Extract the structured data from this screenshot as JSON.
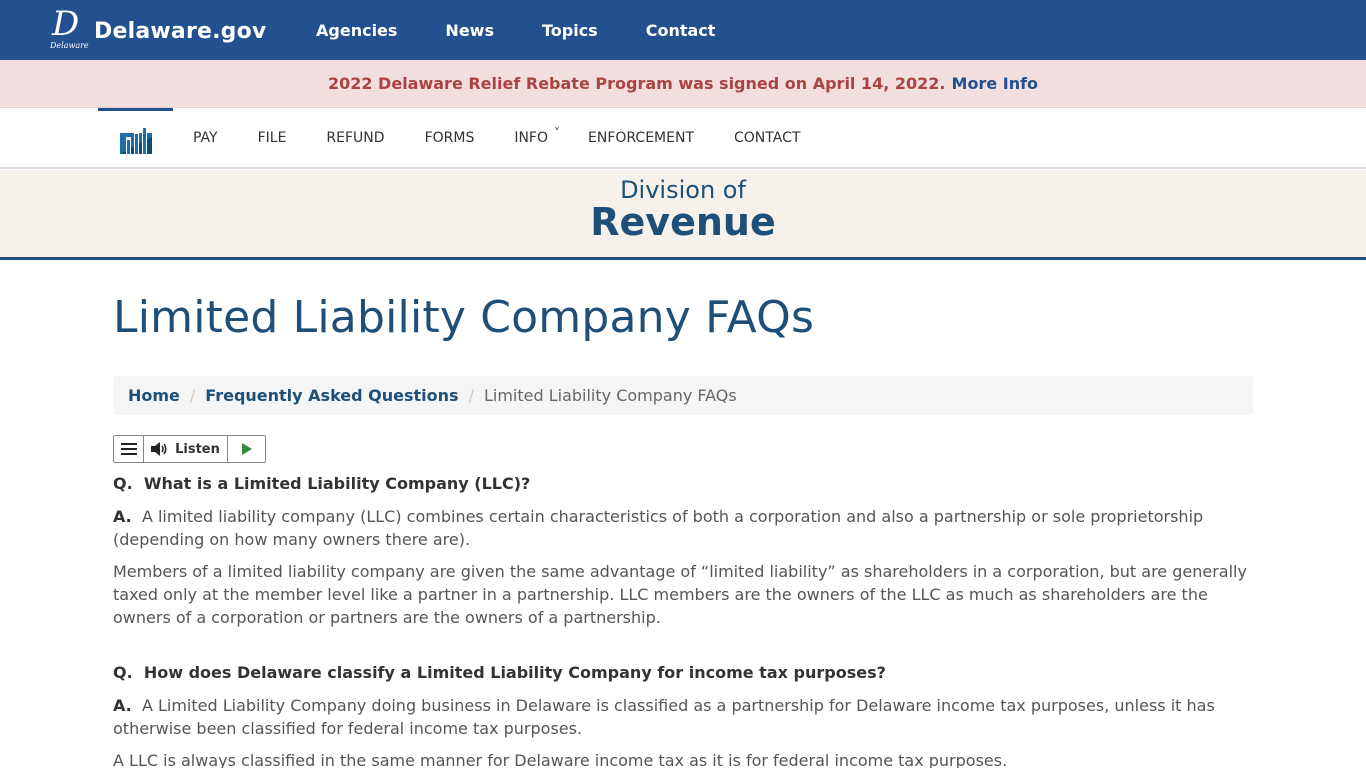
{
  "site": {
    "logo_text": "Delaware.gov",
    "logo_sub": "Delaware",
    "nav": [
      "Agencies",
      "News",
      "Topics",
      "Contact"
    ]
  },
  "alert": {
    "text": "2022 Delaware Relief Rebate Program was signed on April 14, 2022.",
    "link": "More Info"
  },
  "agency_nav": {
    "items": [
      "PAY",
      "FILE",
      "REFUND",
      "FORMS",
      "INFO",
      "ENFORCEMENT",
      "CONTACT"
    ]
  },
  "division": {
    "sub": "Division of",
    "title": "Revenue"
  },
  "page": {
    "title": "Limited Liability Company FAQs"
  },
  "breadcrumb": {
    "home": "Home",
    "parent": "Frequently Asked Questions",
    "current": "Limited Liability Company FAQs",
    "separator": "/"
  },
  "listen": {
    "label": "Listen"
  },
  "faq": [
    {
      "q_prefix": "Q.",
      "question": "What is a Limited Liability Company (LLC)?",
      "a_prefix": "A.",
      "answer": "A limited liability company (LLC) combines certain characteristics of both a corporation and also a partnership or sole proprietorship (depending on how many owners there are).",
      "extra": "Members of a limited liability company are given the same advantage of “limited liability” as shareholders in a corporation, but are generally taxed only at the member level like a partner in a partnership. LLC members are the owners of the LLC as much as shareholders are the owners of a corporation or partners are the owners of a partnership."
    },
    {
      "q_prefix": "Q.",
      "question": "How does Delaware classify a Limited Liability Company for income tax purposes?",
      "a_prefix": "A.",
      "answer": "A Limited Liability Company doing business in Delaware is classified as a partnership for Delaware income tax purposes, unless it has otherwise been classified for federal income tax purposes.",
      "extra": "A LLC is always classified in the same manner for Delaware income tax as it is for federal income tax purposes."
    }
  ],
  "colors": {
    "topbar": "#23508f",
    "alert_bg": "#f2dedf",
    "alert_text": "#a94442",
    "brand": "#1d4f78"
  },
  "icons": {
    "logo": "delaware-d-logo",
    "agency": "revenue-chart-icon",
    "menu": "hamburger-icon",
    "speaker": "speaker-icon",
    "play": "play-icon",
    "caret": "chevron-down-icon"
  }
}
